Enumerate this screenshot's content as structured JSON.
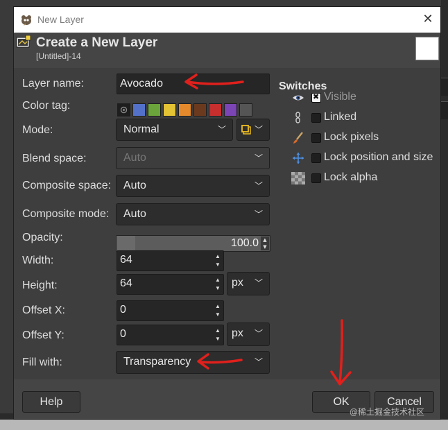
{
  "window": {
    "title": "New Layer",
    "close_glyph": "✕"
  },
  "header": {
    "title": "Create a New Layer",
    "subtitle": "[Untitled]-14"
  },
  "form": {
    "layer_name_label": "Layer name:",
    "layer_name_value": "Avocado",
    "color_tag_label": "Color tag:",
    "color_tags": [
      "#1e1e1e",
      "#5471c9",
      "#6ba43a",
      "#e3c234",
      "#e48a2c",
      "#6b3a1e",
      "#c72e2e",
      "#7b45b5",
      "#555555"
    ],
    "mode_label": "Mode:",
    "mode_value": "Normal",
    "blend_space_label": "Blend space:",
    "blend_space_value": "Auto",
    "composite_space_label": "Composite space:",
    "composite_space_value": "Auto",
    "composite_mode_label": "Composite mode:",
    "composite_mode_value": "Auto",
    "opacity_label": "Opacity:",
    "opacity_value": "100.0",
    "opacity_fraction": 0.12,
    "width_label": "Width:",
    "width_value": "64",
    "height_label": "Height:",
    "height_value": "64",
    "size_unit": "px",
    "offset_x_label": "Offset X:",
    "offset_x_value": "0",
    "offset_y_label": "Offset Y:",
    "offset_y_value": "0",
    "offset_unit": "px",
    "fill_label": "Fill with:",
    "fill_value": "Transparency"
  },
  "switches": {
    "title": "Switches",
    "items": [
      {
        "label": "Visible",
        "icon": "eye-icon",
        "checked": true
      },
      {
        "label": "Linked",
        "icon": "chain-icon",
        "checked": false
      },
      {
        "label": "Lock pixels",
        "icon": "paintbrush-icon",
        "checked": false
      },
      {
        "label": "Lock position and size",
        "icon": "move-icon",
        "checked": false
      },
      {
        "label": "Lock alpha",
        "icon": "checkerboard-icon",
        "checked": false
      }
    ]
  },
  "buttons": {
    "help": "Help",
    "ok": "OK",
    "cancel": "Cancel"
  },
  "watermark": "@稀土掘金技术社区",
  "colors": {
    "annotation_arrow": "#e0201c",
    "window_bg": "#454545",
    "entry_bg": "#262626"
  }
}
